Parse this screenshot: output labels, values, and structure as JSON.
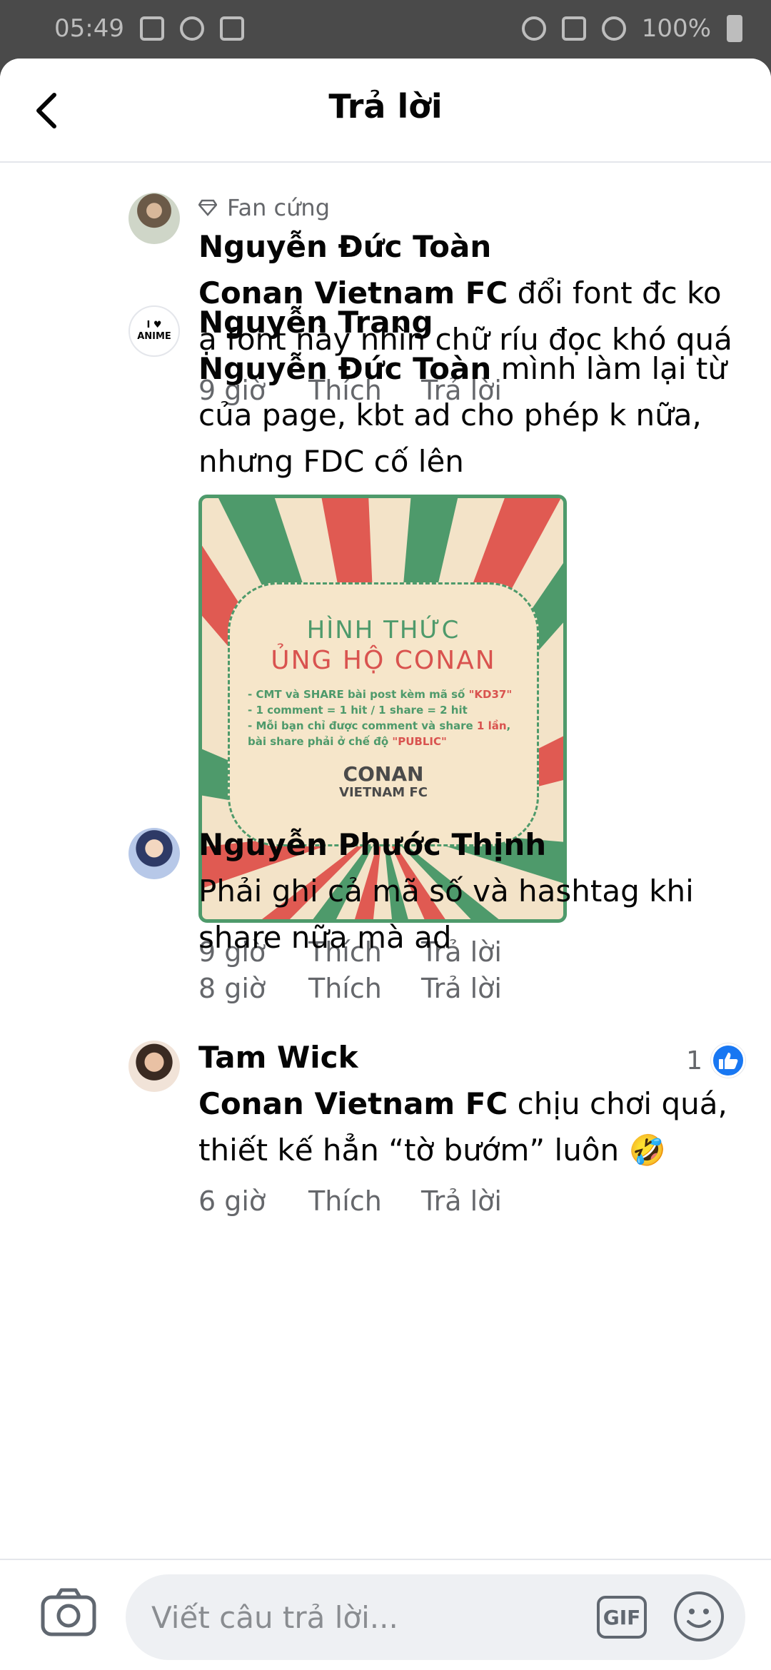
{
  "status_bar": {
    "time": "05:49",
    "battery": "100%"
  },
  "header": {
    "title": "Trả lời",
    "previous_row": [
      "9 giờ",
      "Thích",
      "Trả lời"
    ]
  },
  "comments": [
    {
      "badge": "Fan cứng",
      "author": "Nguyễn Đức Toàn",
      "mention": "Conan Vietnam FC",
      "text": " đổi font đc ko ạ font này nhìn chữ ríu đọc khó quá",
      "time": "9 giờ",
      "like": "Thích",
      "reply": "Trả lời"
    },
    {
      "avatar_text": "I ♥ ANIME",
      "author": "Nguyễn Trang",
      "mention": "Nguyễn Đức Toàn",
      "text": " mình làm lại từ của page, kbt ad cho phép k nữa, nhưng FDC cố lên",
      "poster": {
        "line1": "HÌNH THỨC",
        "line2": "ỦNG HỘ CONAN",
        "rule1a": "- CMT và SHARE bài post kèm mã số ",
        "rule1b": "\"KD37\"",
        "rule2": "- 1 comment = 1 hit / 1 share = 2 hit",
        "rule3a": "- Mỗi bạn chỉ được comment và share ",
        "rule3b": "1 lần",
        "rule3c": ", bài share phải ở chế độ ",
        "rule3d": "\"PUBLIC\"",
        "logo": "CONAN",
        "logo_sub": "VIETNAM FC"
      },
      "time": "9 giờ",
      "like": "Thích",
      "reply": "Trả lời",
      "reaction_count": "1"
    },
    {
      "author": "Nguyễn Phước Thịnh",
      "text": "Phải ghi cả mã số và hashtag khi share nữa mà ad",
      "time": "8 giờ",
      "like": "Thích",
      "reply": "Trả lời"
    },
    {
      "author": "Tam Wick",
      "mention": "Conan Vietnam FC",
      "text": " chịu chơi quá, thiết kế hẳn “tờ bướm” luôn 🤣",
      "time": "6 giờ",
      "like": "Thích",
      "reply": "Trả lời"
    }
  ],
  "composer": {
    "placeholder": "Viết câu trả lời...",
    "gif_label": "GIF"
  }
}
